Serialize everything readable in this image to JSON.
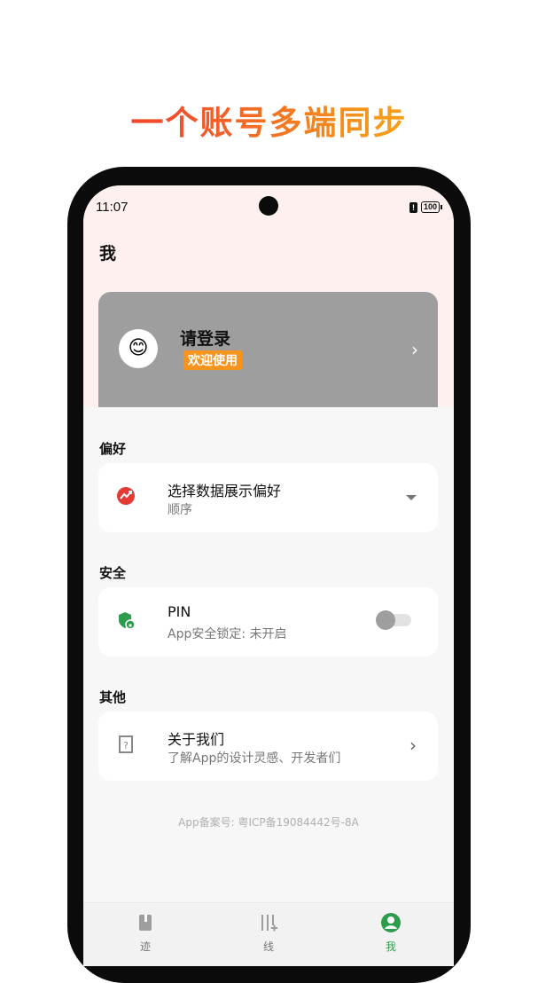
{
  "headline": "一个账号多端同步",
  "status_bar": {
    "time": "11:07",
    "battery": "100"
  },
  "page": {
    "title": "我"
  },
  "login": {
    "title": "请登录",
    "badge": "欢迎使用",
    "avatar": "😊"
  },
  "sections": {
    "preference": {
      "label": "偏好",
      "title": "选择数据展示偏好",
      "subtitle": "顺序"
    },
    "security": {
      "label": "安全",
      "title": "PIN",
      "subtitle": "App安全锁定: 未开启",
      "enabled": false
    },
    "other": {
      "label": "其他",
      "title": "关于我们",
      "subtitle": "了解App的设计灵感、开发者们"
    }
  },
  "footer": {
    "beian": "App备案号: 粤ICP备19084442号-8A"
  },
  "tabbar": {
    "items": [
      {
        "label": "迹",
        "icon": "book-icon"
      },
      {
        "label": "线",
        "icon": "timeline-icon"
      },
      {
        "label": "我",
        "icon": "profile-icon"
      }
    ],
    "active": "我",
    "active_color": "#2e9c4f"
  },
  "colors": {
    "accent_orange": "#f7941d",
    "headline_gradient": [
      "#ef2b2b",
      "#f7b514"
    ],
    "login_card_bg": "#9e9e9e"
  }
}
